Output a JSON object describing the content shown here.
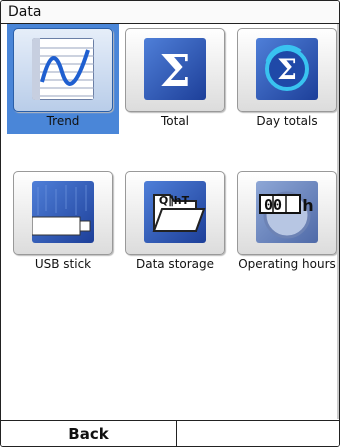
{
  "window": {
    "title": "Data"
  },
  "tiles": [
    {
      "label": "Trend",
      "icon": "trend-chart-icon",
      "selected": true
    },
    {
      "label": "Total",
      "icon": "sigma-total-icon",
      "selected": false
    },
    {
      "label": "Day totals",
      "icon": "day-sigma-icon",
      "selected": false
    },
    {
      "label": "USB stick",
      "icon": "usb-stick-icon",
      "selected": false
    },
    {
      "label": "Data storage",
      "icon": "folder-storage-icon",
      "selected": false
    },
    {
      "label": "Operating hours",
      "icon": "hour-counter-icon",
      "selected": false
    }
  ],
  "icons": {
    "total_symbol": "Σ",
    "day_symbol": "Σ",
    "storage_text": "Q∥hT",
    "counter_digits": "00",
    "counter_unit": "h"
  },
  "footer": {
    "back_label": "Back",
    "right_label": ""
  },
  "colors": {
    "selection": "#4a86d8",
    "icon_blue": "#2a55b8"
  }
}
